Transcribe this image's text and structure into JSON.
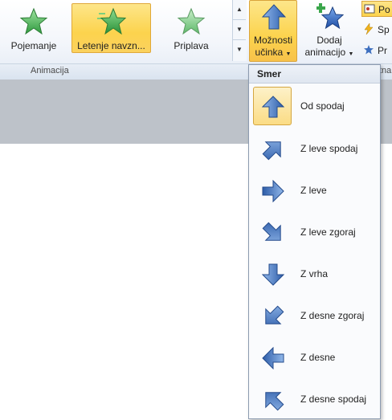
{
  "ribbon": {
    "gallery": [
      {
        "label": "Pojemanje",
        "icon": "green-star-fade-icon",
        "selected": false
      },
      {
        "label": "Letenje navzn...",
        "icon": "green-star-fly-icon",
        "selected": true
      },
      {
        "label": "Priplava",
        "icon": "green-star-float-icon",
        "selected": false
      }
    ],
    "group_label_animation": "Animacija",
    "effect_options": {
      "line1": "Možnosti",
      "line2": "učinka"
    },
    "add_animation": {
      "line1": "Dodaj",
      "line2": "animacijo"
    },
    "small_buttons": [
      {
        "label": "Po",
        "icon": "animation-pane-icon"
      },
      {
        "label": "Sp",
        "icon": "trigger-lightning-icon"
      },
      {
        "label": "Pr",
        "icon": "animation-painter-icon"
      }
    ],
    "partial_group_label": "tna"
  },
  "dropdown": {
    "header": "Smer",
    "items": [
      {
        "label": "Od spodaj",
        "icon": "arrow-up-icon",
        "selected": true
      },
      {
        "label": "Z leve spodaj",
        "icon": "arrow-up-right-icon",
        "selected": false
      },
      {
        "label": "Z leve",
        "icon": "arrow-right-icon",
        "selected": false
      },
      {
        "label": "Z leve zgoraj",
        "icon": "arrow-down-right-icon",
        "selected": false
      },
      {
        "label": "Z vrha",
        "icon": "arrow-down-icon",
        "selected": false
      },
      {
        "label": "Z desne zgoraj",
        "icon": "arrow-down-left-icon",
        "selected": false
      },
      {
        "label": "Z desne",
        "icon": "arrow-left-icon",
        "selected": false
      },
      {
        "label": "Z desne spodaj",
        "icon": "arrow-up-left-icon",
        "selected": false
      }
    ]
  },
  "colors": {
    "accent_gold": "#fcd34d",
    "arrow_blue": "#3d6fbf",
    "star_green": "#3aa64b"
  }
}
